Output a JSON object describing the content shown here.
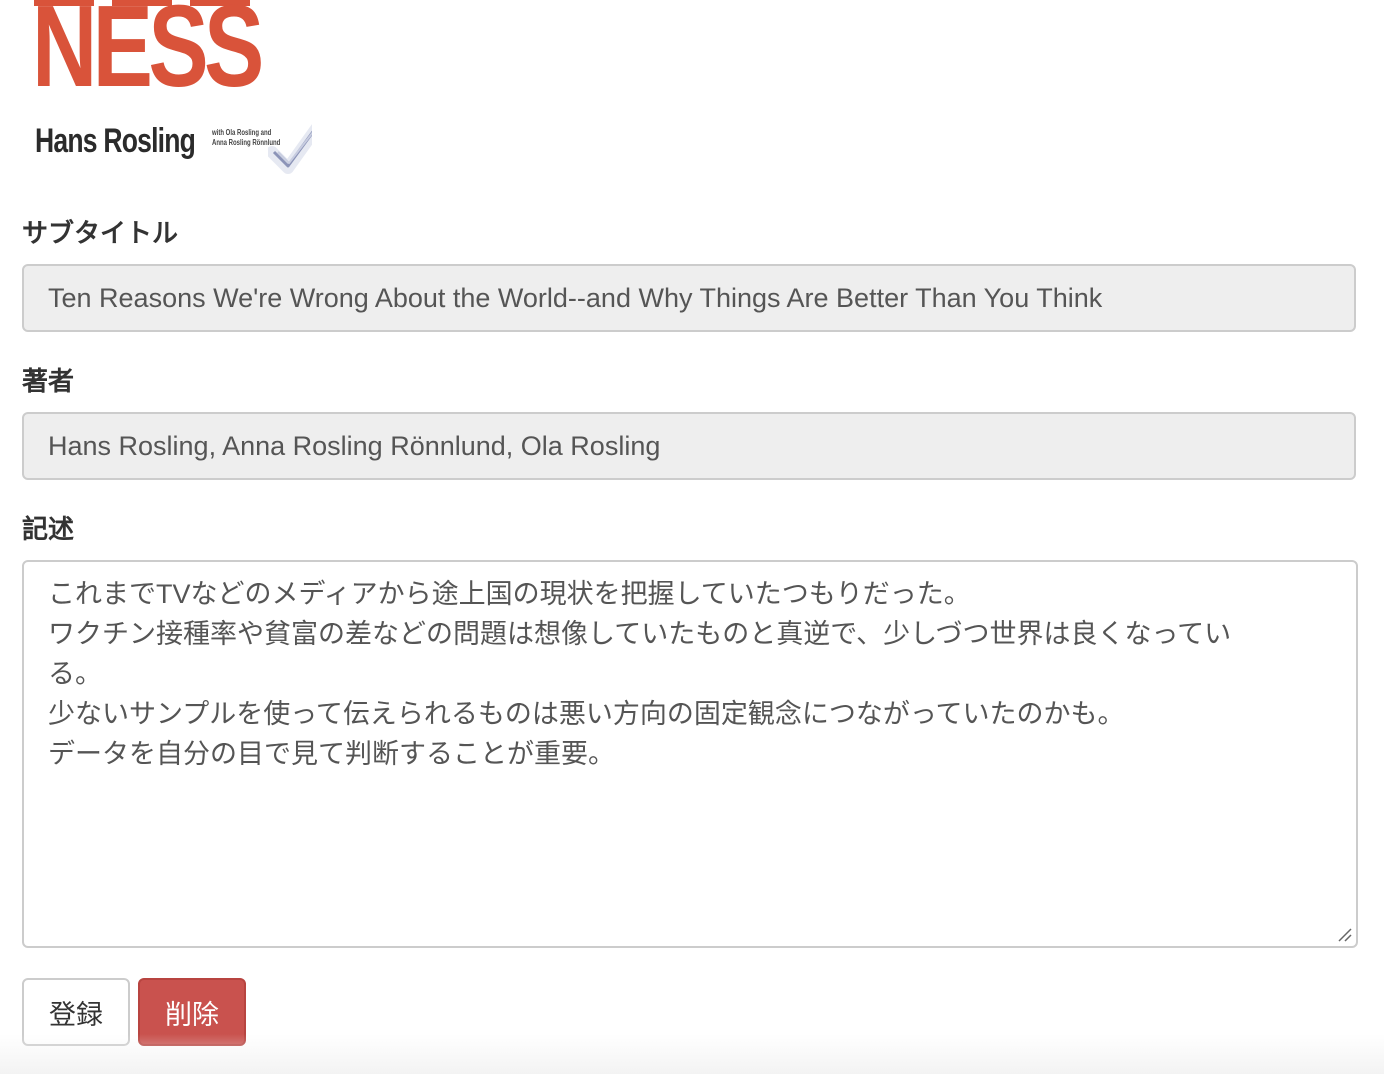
{
  "cover": {
    "title": "NESS",
    "author": "Hans Rosling",
    "credit_line1": "with Ola Rosling and",
    "credit_line2": "Anna Rosling Rönnlund"
  },
  "form": {
    "subtitle": {
      "label": "サブタイトル",
      "value": "Ten Reasons We're Wrong About the World--and Why Things Are Better Than You Think"
    },
    "authors": {
      "label": "著者",
      "value": "Hans Rosling, Anna Rosling Rönnlund, Ola Rosling"
    },
    "description": {
      "label": "記述",
      "lines": [
        "これまでTVなどのメディアから途上国の現状を把握していたつもりだった。",
        "ワクチン接種率や貧富の差などの問題は想像していたものと真逆で、少しづつ世界は良くなっている。",
        "少ないサンプルを使って伝えられるものは悪い方向の固定観念につながっていたのかも。",
        "データを自分の目で見て判断することが重要。"
      ]
    }
  },
  "buttons": {
    "register": "登録",
    "delete": "削除"
  },
  "colors": {
    "cover_red": "#d9533a",
    "danger": "#c9524e",
    "readonly_bg": "#eeeeee",
    "border": "#cccccc"
  }
}
